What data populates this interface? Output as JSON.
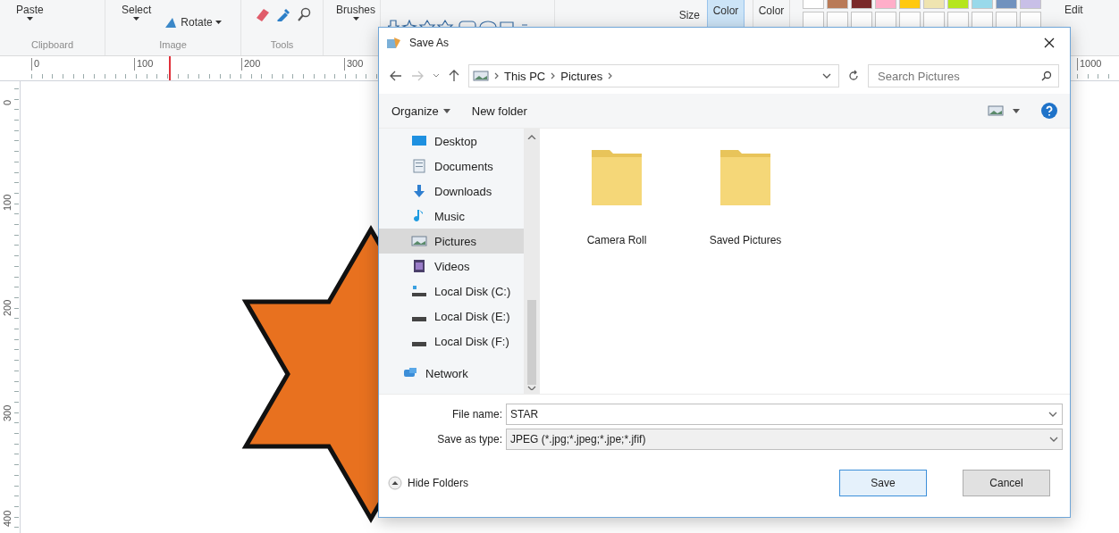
{
  "ribbon": {
    "paste": "Paste",
    "select": "Select",
    "rotate": "Rotate",
    "brushes": "Brushes",
    "size": "Size",
    "color_buttons": [
      {
        "label": "Color",
        "selected": true
      },
      {
        "label": "Color",
        "selected": false
      }
    ],
    "palette": [
      {
        "color": "#ffffff"
      },
      {
        "color": "#b97a57"
      },
      {
        "color": "#7a2a2a"
      },
      {
        "color": "#ffaec9"
      },
      {
        "color": "#ffc90e"
      },
      {
        "color": "#efe4b0"
      },
      {
        "color": "#b5e61d"
      },
      {
        "color": "#99d9ea"
      },
      {
        "color": "#7092be"
      },
      {
        "color": "#c8bfe7"
      }
    ],
    "edit_colors": "Edit",
    "group_labels": [
      "Clipboard",
      "Image",
      "Tools"
    ]
  },
  "ruler": {
    "horizontal": [
      "0",
      "100",
      "200",
      "300",
      "1000"
    ],
    "vertical": [
      "0",
      "100",
      "200",
      "300",
      "400"
    ]
  },
  "dialog": {
    "title": "Save As",
    "breadcrumb": [
      "This PC",
      "Pictures"
    ],
    "search_placeholder": "Search Pictures",
    "organize": "Organize",
    "new_folder": "New folder",
    "nav_items": [
      {
        "label": "Desktop",
        "kind": "desktop",
        "selected": false
      },
      {
        "label": "Documents",
        "kind": "documents",
        "selected": false
      },
      {
        "label": "Downloads",
        "kind": "downloads",
        "selected": false
      },
      {
        "label": "Music",
        "kind": "music",
        "selected": false
      },
      {
        "label": "Pictures",
        "kind": "pictures",
        "selected": true
      },
      {
        "label": "Videos",
        "kind": "videos",
        "selected": false
      },
      {
        "label": "Local Disk (C:)",
        "kind": "system-drive",
        "selected": false
      },
      {
        "label": "Local Disk (E:)",
        "kind": "drive",
        "selected": false
      },
      {
        "label": "Local Disk (F:)",
        "kind": "drive",
        "selected": false
      }
    ],
    "nav_root_items": [
      {
        "label": "Network",
        "kind": "network",
        "selected": false
      }
    ],
    "folders": [
      {
        "name": "Camera Roll"
      },
      {
        "name": "Saved Pictures"
      }
    ],
    "file_name_label": "File name:",
    "file_name": "STAR",
    "type_label": "Save as type:",
    "save_as_type": "JPEG (*.jpg;*.jpeg;*.jpe;*.jfif)",
    "hide_folders": "Hide Folders",
    "buttons": [
      {
        "label": "Save",
        "kind": "primary"
      },
      {
        "label": "Cancel",
        "kind": "secondary"
      }
    ]
  }
}
